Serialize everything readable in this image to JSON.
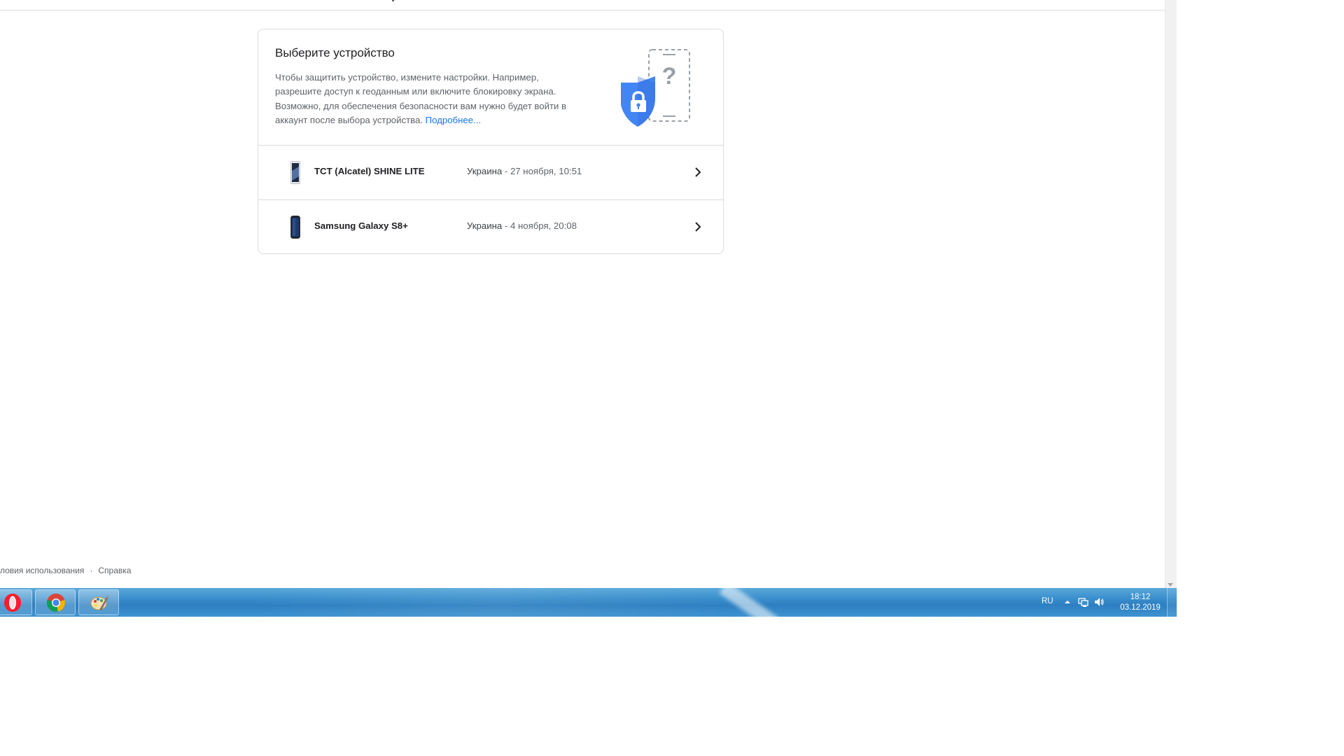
{
  "card": {
    "title": "Выберите устройство",
    "description": "Чтобы защитить устройство, измените настройки. Например, разрешите доступ к геоданным или включите блокировку экрана. Возможно, для обеспечения безопасности вам нужно будет войти в аккаунт после выбора устройства.",
    "learn_more": "Подробнее...",
    "illustration_icon": "shield-lock-phone-icon",
    "devices": [
      {
        "name": "TCT (Alcatel) SHINE LITE",
        "location": "Украина",
        "separator": " - ",
        "time": "27 ноября, 10:51",
        "icon": "phone-icon"
      },
      {
        "name": "Samsung Galaxy S8+",
        "location": "Украина",
        "separator": " - ",
        "time": "4 ноября, 20:08",
        "icon": "phone-icon"
      }
    ]
  },
  "footer": {
    "terms": "ловия использования",
    "separator": "·",
    "help": "Справка"
  },
  "taskbar": {
    "apps": [
      {
        "name": "Opera",
        "icon": "opera-icon"
      },
      {
        "name": "Google Chrome",
        "icon": "chrome-icon"
      },
      {
        "name": "Paint",
        "icon": "paint-icon"
      }
    ],
    "tray": {
      "language": "RU",
      "time": "18:12",
      "date": "03.12.2019"
    }
  },
  "colors": {
    "link": "#1a73e8",
    "shield": "#4285f4",
    "taskbar": "#3a8fcc"
  }
}
